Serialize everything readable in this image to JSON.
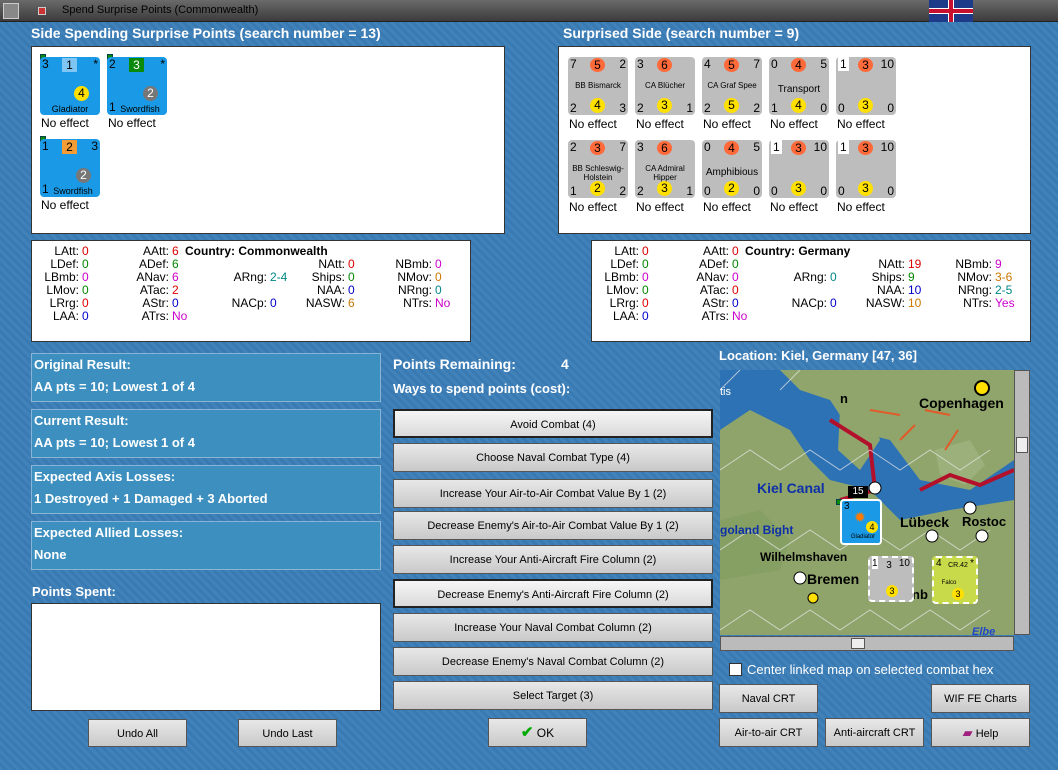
{
  "window": {
    "title": "Spend Surprise Points (Commonwealth)"
  },
  "spending": {
    "header": "Side Spending Surprise Points (search number = 13)",
    "units": [
      {
        "tl": "3",
        "tc": "1",
        "tr": "*",
        "bc": "4",
        "name": "Gladiator",
        "effect": "No effect"
      },
      {
        "tl": "2",
        "tc": "3",
        "tr": "*",
        "bl": "1",
        "bc": "2",
        "name": "Swordfish",
        "effect": "No effect"
      },
      {
        "tl": "1",
        "tc": "2",
        "tr": "3",
        "bl": "1",
        "bc": "2",
        "name": "Swordfish",
        "effect": "No effect"
      }
    ]
  },
  "surprised": {
    "header": "Surprised Side (search number = 9)",
    "units": [
      {
        "tl": "7",
        "tc": "5",
        "tr": "2",
        "bl": "2",
        "bc": "4",
        "br": "3",
        "name": "BB Bismarck",
        "effect": "No effect"
      },
      {
        "tl": "3",
        "tc": "6",
        "tr": "",
        "bl": "2",
        "bc": "3",
        "br": "1",
        "name": "CA Blücher",
        "effect": "No effect"
      },
      {
        "tl": "4",
        "tc": "5",
        "tr": "7",
        "bl": "2",
        "bc": "5",
        "br": "2",
        "name": "CA Graf Spee",
        "effect": "No effect"
      },
      {
        "tl": "0",
        "tc": "4",
        "tr": "5",
        "bl": "1",
        "bc": "4",
        "br": "0",
        "name": "Transport",
        "effect": "No effect"
      },
      {
        "tl": "1",
        "tc": "3",
        "tr": "10",
        "bl": "0",
        "bc": "3",
        "br": "0",
        "name": "",
        "effect": "No effect"
      },
      {
        "tl": "2",
        "tc": "3",
        "tr": "7",
        "bl": "1",
        "bc": "2",
        "br": "2",
        "name": "BB Schleswig-Holstein",
        "effect": "No effect"
      },
      {
        "tl": "3",
        "tc": "6",
        "tr": "",
        "bl": "2",
        "bc": "3",
        "br": "1",
        "name": "CA Admiral Hipper",
        "effect": "No effect"
      },
      {
        "tl": "0",
        "tc": "4",
        "tr": "5",
        "bl": "0",
        "bc": "2",
        "br": "0",
        "name": "Amphibious",
        "effect": "No effect"
      },
      {
        "tl": "1",
        "tc": "3",
        "tr": "10",
        "bl": "0",
        "bc": "3",
        "br": "0",
        "name": "",
        "effect": "No effect"
      },
      {
        "tl": "1",
        "tc": "3",
        "tr": "10",
        "bl": "0",
        "bc": "3",
        "br": "0",
        "name": "",
        "effect": "No effect"
      }
    ]
  },
  "stats_left": {
    "country": "Country: Commonwealth",
    "col1": [
      [
        "LAtt:",
        "0"
      ],
      [
        "LDef:",
        "0"
      ],
      [
        "LBmb:",
        "0"
      ],
      [
        "LMov:",
        "0"
      ],
      [
        "LRrg:",
        "0"
      ],
      [
        "LAA:",
        "0"
      ]
    ],
    "col2": [
      [
        "AAtt:",
        "6"
      ],
      [
        "ADef:",
        "6"
      ],
      [
        "ANav:",
        "6"
      ],
      [
        "ATac:",
        "2"
      ],
      [
        "AStr:",
        "0"
      ],
      [
        "ATrs:",
        "No"
      ]
    ],
    "col3": [
      [
        "ARng:",
        "2-4"
      ],
      [
        "NACp:",
        "0"
      ]
    ],
    "col4": [
      [
        "NAtt:",
        "0"
      ],
      [
        "Ships:",
        "0"
      ],
      [
        "NAA:",
        "0"
      ],
      [
        "NASW:",
        "6"
      ]
    ],
    "col5": [
      [
        "NBmb:",
        "0"
      ],
      [
        "NMov:",
        "0"
      ],
      [
        "NRng:",
        "0"
      ],
      [
        "NTrs:",
        "No"
      ]
    ]
  },
  "stats_right": {
    "country": "Country: Germany",
    "col1": [
      [
        "LAtt:",
        "0"
      ],
      [
        "LDef:",
        "0"
      ],
      [
        "LBmb:",
        "0"
      ],
      [
        "LMov:",
        "0"
      ],
      [
        "LRrg:",
        "0"
      ],
      [
        "LAA:",
        "0"
      ]
    ],
    "col2": [
      [
        "AAtt:",
        "0"
      ],
      [
        "ADef:",
        "0"
      ],
      [
        "ANav:",
        "0"
      ],
      [
        "ATac:",
        "0"
      ],
      [
        "AStr:",
        "0"
      ],
      [
        "ATrs:",
        "No"
      ]
    ],
    "col3": [
      [
        "ARng:",
        "0"
      ],
      [
        "NACp:",
        "0"
      ]
    ],
    "col4": [
      [
        "NAtt:",
        "19"
      ],
      [
        "Ships:",
        "9"
      ],
      [
        "NAA:",
        "10"
      ],
      [
        "NASW:",
        "10"
      ]
    ],
    "col5": [
      [
        "NBmb:",
        "9"
      ],
      [
        "NMov:",
        "3-6"
      ],
      [
        "NRng:",
        "2-5"
      ],
      [
        "NTrs:",
        "Yes"
      ]
    ]
  },
  "results": {
    "original_h": "Original Result:",
    "original_b": "AA pts = 10; Lowest 1 of 4",
    "current_h": "Current Result:",
    "current_b": "AA pts = 10; Lowest 1 of 4",
    "axis_h": "Expected Axis Losses:",
    "axis_b": "1 Destroyed + 1 Damaged + 3 Aborted",
    "allied_h": "Expected Allied Losses:",
    "allied_b": "None",
    "spent_h": "Points Spent:"
  },
  "points": {
    "remaining_label": "Points Remaining:",
    "remaining_value": "4",
    "ways": "Ways to spend points (cost):"
  },
  "options": [
    "Avoid Combat (4)",
    "Choose Naval Combat Type (4)",
    "Increase Your Air-to-Air Combat Value By 1 (2)",
    "Decrease Enemy's Air-to-Air Combat Value By 1 (2)",
    "Increase Your Anti-Aircraft Fire Column (2)",
    "Decrease Enemy's Anti-Aircraft Fire Column (2)",
    "Increase Your Naval Combat Column (2)",
    "Decrease Enemy's Naval Combat Column (2)",
    "Select Target (3)"
  ],
  "buttons": {
    "undo_all": "Undo All",
    "undo_last": "Undo Last",
    "ok": "OK",
    "naval_crt": "Naval CRT",
    "wif_charts": "WIF FE Charts",
    "air_crt": "Air-to-air CRT",
    "aa_crt": "Anti-aircraft CRT",
    "help": "Help"
  },
  "map": {
    "location": "Location: Kiel, Germany [47, 36]",
    "labels": {
      "copenhagen": "Copenhagen",
      "kiel": "Kiel Canal",
      "lubeck": "Lübeck",
      "rostock": "Rostoc",
      "bight": "goland Bight",
      "wilhelm": "Wilhelmshaven",
      "bremen": "Bremen",
      "elbe": "Elbe",
      "tis": "tis",
      "n": "n",
      "b": "b",
      "nb": "nb"
    },
    "stack": "15",
    "unit_gladiator": {
      "tl": "3",
      "bc": "4",
      "name": "Gladiator"
    },
    "unit_falco": {
      "tl": "4",
      "tc": "CR.42",
      "tr": "*",
      "bc": "3",
      "name": "Falco"
    },
    "unit_ship": {
      "tl": "1",
      "tc": "3",
      "tr": "10",
      "bc": "3"
    },
    "center_label": "Center linked map on selected combat hex"
  }
}
